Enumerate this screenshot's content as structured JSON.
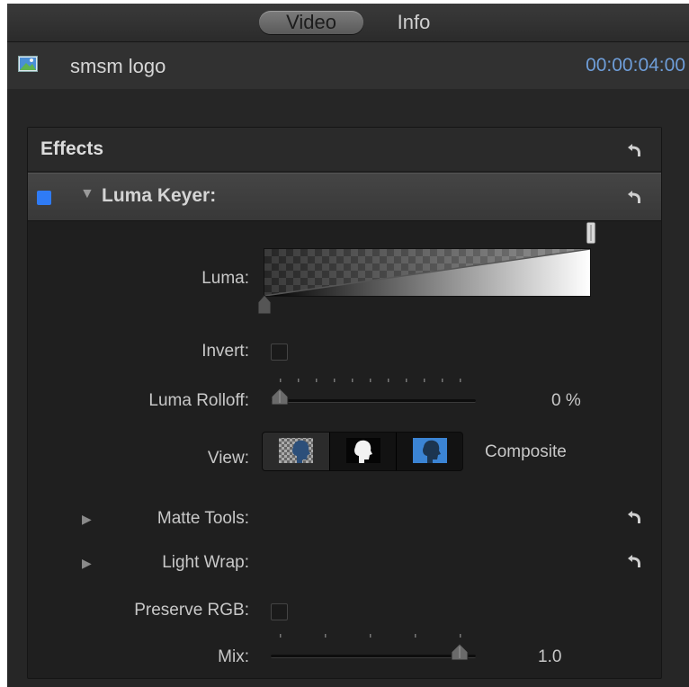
{
  "tabs": [
    {
      "label": "Video",
      "active": true
    },
    {
      "label": "Info",
      "active": false
    }
  ],
  "clip": {
    "icon": "image-icon",
    "name": "smsm logo",
    "duration": "00:00:04:00"
  },
  "effects": {
    "title": "Effects",
    "keyer": {
      "enabled": true,
      "title": "Luma Keyer:",
      "params": {
        "luma": {
          "label": "Luma:"
        },
        "invert": {
          "label": "Invert:",
          "checked": false
        },
        "luma_rolloff": {
          "label": "Luma Rolloff:",
          "value": "0 %",
          "level": 0.0
        },
        "view": {
          "label": "View:",
          "options": [
            "composite-checker-icon",
            "matte-icon",
            "composite-blue-icon"
          ],
          "selected_text": "Composite"
        },
        "matte_tools": {
          "label": "Matte Tools:"
        },
        "light_wrap": {
          "label": "Light Wrap:"
        },
        "preserve_rgb": {
          "label": "Preserve RGB:",
          "checked": false
        },
        "mix": {
          "label": "Mix:",
          "value": "1.0",
          "level": 1.0
        }
      }
    }
  },
  "colors": {
    "accent": "#2f7bf5",
    "timecode": "#6e9dd8",
    "panel_bg": "#262626"
  }
}
